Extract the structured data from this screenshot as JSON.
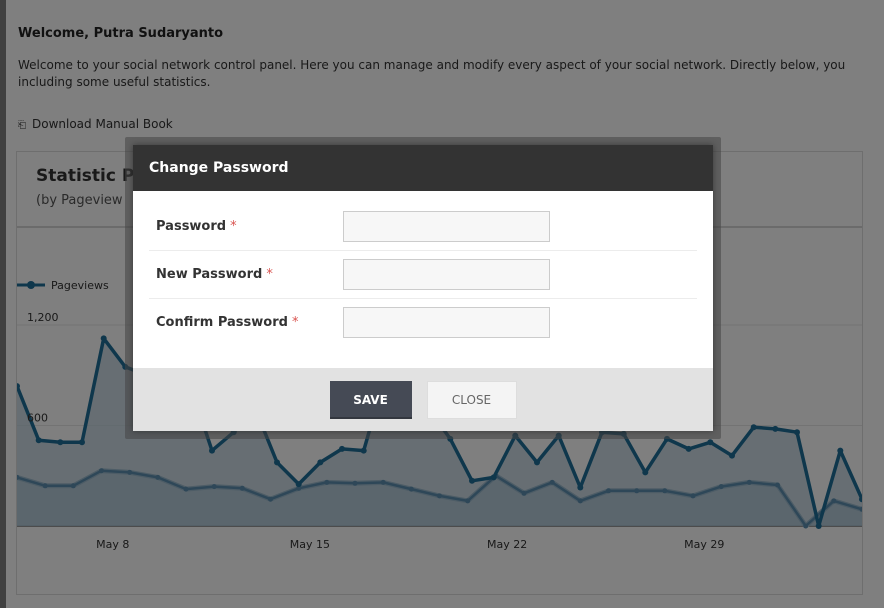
{
  "page": {
    "welcome_title": "Welcome, Putra Sudaryanto",
    "welcome_text": "Welcome to your social network control panel. Here you can manage and modify every aspect of your social network. Directly below, you",
    "welcome_text_2": "including some useful statistics.",
    "download_link": "Download Manual Book",
    "download_icon": "book-icon"
  },
  "stats": {
    "title": "Statistic P",
    "subtitle": "(by Pageview"
  },
  "chart_data": {
    "type": "line",
    "legend": [
      "Pageviews"
    ],
    "y_ticks": [
      "1,200",
      "600"
    ],
    "y_tick_values": [
      1200,
      600
    ],
    "ylim": [
      0,
      1200
    ],
    "x_ticks": [
      "May 8",
      "May 15",
      "May 22",
      "May 29"
    ],
    "x_tick_index": [
      3,
      10,
      17,
      24
    ],
    "series": [
      {
        "name": "Pageviews",
        "color": "#1f6f98",
        "values": [
          835,
          512,
          500,
          500,
          1120,
          950,
          900,
          860,
          840,
          450,
          560,
          700,
          380,
          250,
          380,
          460,
          450,
          900,
          880,
          700,
          520,
          270,
          290,
          540,
          380,
          540,
          230,
          560,
          550,
          320,
          520,
          460,
          500,
          420,
          590,
          580,
          560,
          0,
          450,
          160
        ]
      },
      {
        "name": "",
        "color": "#5c8fb0",
        "values": [
          290,
          240,
          240,
          330,
          320,
          290,
          220,
          235,
          225,
          160,
          225,
          260,
          255,
          260,
          220,
          180,
          150,
          300,
          195,
          260,
          150,
          210,
          210,
          210,
          180,
          235,
          260,
          245,
          0,
          150,
          100
        ]
      }
    ]
  },
  "modal": {
    "title": "Change Password",
    "fields": [
      {
        "label": "Password",
        "required": "*",
        "value": "",
        "placeholder": ""
      },
      {
        "label": "New Password",
        "required": "*",
        "value": "",
        "placeholder": ""
      },
      {
        "label": "Confirm Password",
        "required": "*",
        "value": "",
        "placeholder": ""
      }
    ],
    "save_label": "SAVE",
    "close_label": "CLOSE"
  }
}
